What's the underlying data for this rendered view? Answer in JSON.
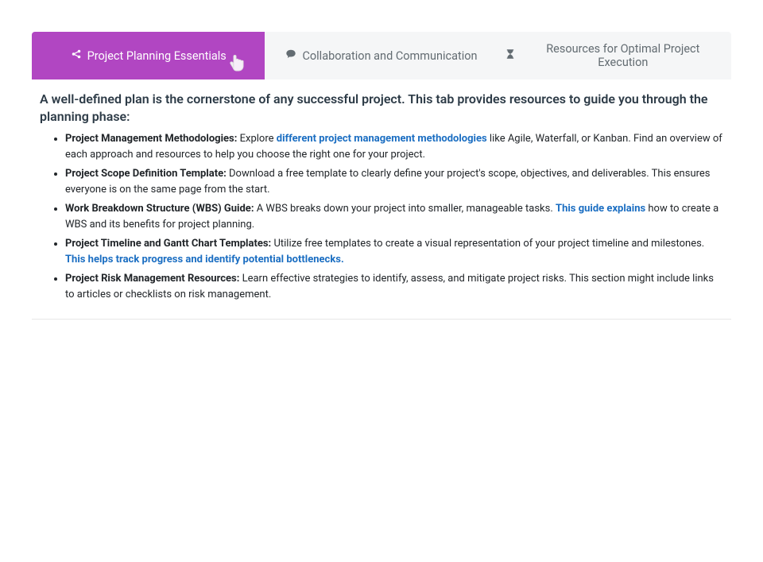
{
  "tabs": [
    {
      "label": "Project Planning Essentials",
      "icon": "share-nodes-icon",
      "active": true
    },
    {
      "label": "Collaboration and Communication",
      "icon": "comment-icon",
      "active": false
    },
    {
      "label": "Resources for Optimal Project Execution",
      "icon": "hourglass-icon",
      "active": false
    }
  ],
  "heading": "A well-defined plan is the cornerstone of any successful project. This tab provides resources to guide you through the planning phase:",
  "items": [
    {
      "title": "Project Management Methodologies:",
      "pre": " Explore ",
      "link": "different project management methodologies",
      "post": " like Agile, Waterfall, or Kanban. Find an overview of each approach and resources to help you choose the right one for your project."
    },
    {
      "title": "Project Scope Definition Template:",
      "pre": " Download a free template to clearly define your project's scope, objectives, and deliverables. This ensures everyone is on the same page from the start.",
      "link": "",
      "post": ""
    },
    {
      "title": "Work Breakdown Structure (WBS) Guide:",
      "pre": " A WBS breaks down your project into smaller, manageable tasks. ",
      "link": "This guide explains",
      "post": " how to create a WBS and its benefits for project planning."
    },
    {
      "title": "Project Timeline and Gantt Chart Templates:",
      "pre": " Utilize free templates to create a visual representation of your project timeline and milestones. ",
      "link": "This helps track progress and identify potential bottlenecks.",
      "post": ""
    },
    {
      "title": "Project Risk Management Resources:",
      "pre": " Learn effective strategies to identify, assess, and mitigate project risks. This section might include links to articles or checklists on risk management.",
      "link": "",
      "post": ""
    }
  ]
}
